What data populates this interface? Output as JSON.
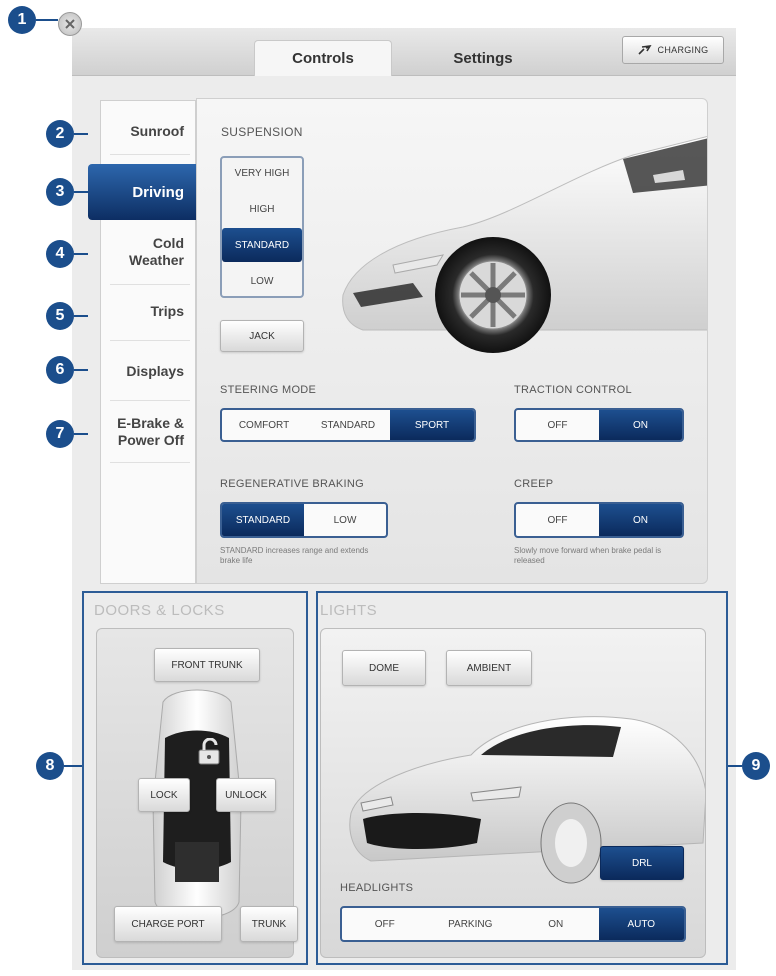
{
  "callouts": [
    "1",
    "2",
    "3",
    "4",
    "5",
    "6",
    "7",
    "8",
    "9"
  ],
  "close_icon": "close-icon",
  "tabs": [
    {
      "label": "Controls",
      "active": true
    },
    {
      "label": "Settings",
      "active": false
    }
  ],
  "charging_button": {
    "label": "CHARGING",
    "icon": "charging-plug-icon"
  },
  "sidebar": {
    "items": [
      {
        "label": "Sunroof",
        "selected": false
      },
      {
        "label": "Driving",
        "selected": true
      },
      {
        "label": "Cold Weather",
        "selected": false
      },
      {
        "label": "Trips",
        "selected": false
      },
      {
        "label": "Displays",
        "selected": false
      },
      {
        "label": "E-Brake & Power Off",
        "selected": false
      }
    ]
  },
  "driving": {
    "suspension": {
      "label": "SUSPENSION",
      "options": [
        "VERY HIGH",
        "HIGH",
        "STANDARD",
        "LOW"
      ],
      "selected": "STANDARD"
    },
    "jack_label": "JACK",
    "steering_mode": {
      "label": "STEERING MODE",
      "options": [
        "COMFORT",
        "STANDARD",
        "SPORT"
      ],
      "selected": "SPORT"
    },
    "traction_control": {
      "label": "TRACTION CONTROL",
      "options": [
        "OFF",
        "ON"
      ],
      "selected": "ON"
    },
    "regenerative_braking": {
      "label": "REGENERATIVE BRAKING",
      "options": [
        "STANDARD",
        "LOW"
      ],
      "selected": "STANDARD",
      "hint": "STANDARD increases range and extends brake life"
    },
    "creep": {
      "label": "CREEP",
      "options": [
        "OFF",
        "ON"
      ],
      "selected": "ON",
      "hint": "Slowly move forward when brake pedal is released"
    }
  },
  "doors_locks": {
    "title": "DOORS & LOCKS",
    "front_trunk": "FRONT TRUNK",
    "lock": "LOCK",
    "unlock": "UNLOCK",
    "charge_port": "CHARGE PORT",
    "trunk": "TRUNK"
  },
  "lights": {
    "title": "LIGHTS",
    "dome": "DOME",
    "ambient": "AMBIENT",
    "drl": "DRL",
    "headlights": {
      "label": "HEADLIGHTS",
      "options": [
        "OFF",
        "PARKING",
        "ON",
        "AUTO"
      ],
      "selected": "AUTO"
    }
  },
  "colors": {
    "accent": "#0b2a5c",
    "callout": "#1b4e8c",
    "frame": "#2c5c96"
  }
}
